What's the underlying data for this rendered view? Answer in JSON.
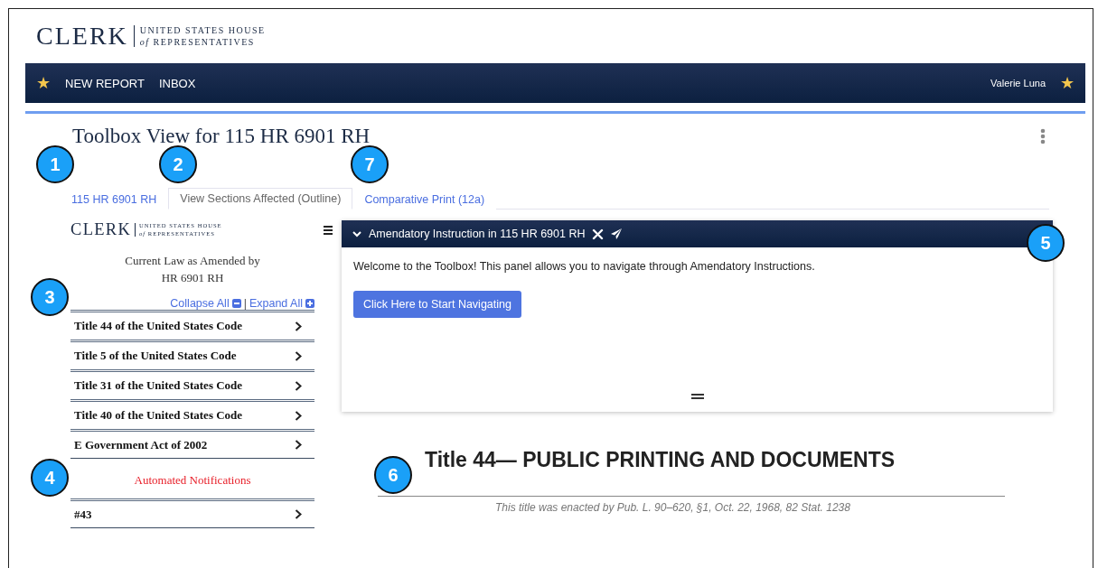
{
  "logo": {
    "wordmark": "CLERK",
    "line_1": "UNITED STATES HOUSE",
    "line_2": "*of* REPRESENTATIVES"
  },
  "navbar": {
    "items": [
      {
        "label": "NEW REPORT"
      },
      {
        "label": "INBOX"
      }
    ],
    "user": "Valerie Luna",
    "star_left": "★",
    "star_right": "★"
  },
  "page_title": "Toolbox View for 115 HR 6901 RH",
  "tabs": [
    {
      "label": "115 HR 6901 RH",
      "selected": false
    },
    {
      "label": "View Sections Affected (Outline)",
      "selected": true
    },
    {
      "label": "Comparative Print (12a)",
      "selected": false
    }
  ],
  "sidebar": {
    "logo": {
      "wordmark": "CLERK",
      "line_1": "UNITED STATES HOUSE",
      "line_2": "*of* REPRESENTATIVES"
    },
    "heading_1": "Current Law as Amended by",
    "heading_2": "HR 6901 RH",
    "collapse_all": "Collapse All",
    "separator": "|",
    "expand_all": "Expand All",
    "items": [
      {
        "label": "Title 44 of the United States Code"
      },
      {
        "label": "Title 5 of the United States Code"
      },
      {
        "label": "Title 31 of the United States Code"
      },
      {
        "label": "Title 40 of the United States Code"
      },
      {
        "label": "E Government Act of 2002"
      }
    ],
    "notifications_heading": "Automated Notifications",
    "notifications": [
      {
        "label": "#43"
      }
    ]
  },
  "panel": {
    "title": "Amendatory Instruction in 115 HR 6901 RH",
    "expanded": true,
    "message": "Welcome to the Toolbox! This panel allows you to navigate through Amendatory Instructions.",
    "button": "Click Here to Start Navigating"
  },
  "document": {
    "heading": "Title 44— PUBLIC PRINTING AND DOCUMENTS",
    "caption": "This title was enacted by Pub. L. 90–620, §1, Oct. 22, 1968, 82 Stat. 1238"
  },
  "callouts": [
    {
      "label": "1",
      "kind": "tab_1"
    },
    {
      "label": "2",
      "kind": "tab_2"
    },
    {
      "label": "7",
      "kind": "tab_3"
    },
    {
      "label": "3",
      "kind": "sidebar"
    },
    {
      "label": "4",
      "kind": "notifications"
    },
    {
      "label": "5",
      "kind": "panel"
    },
    {
      "label": "6",
      "kind": "document"
    }
  ]
}
